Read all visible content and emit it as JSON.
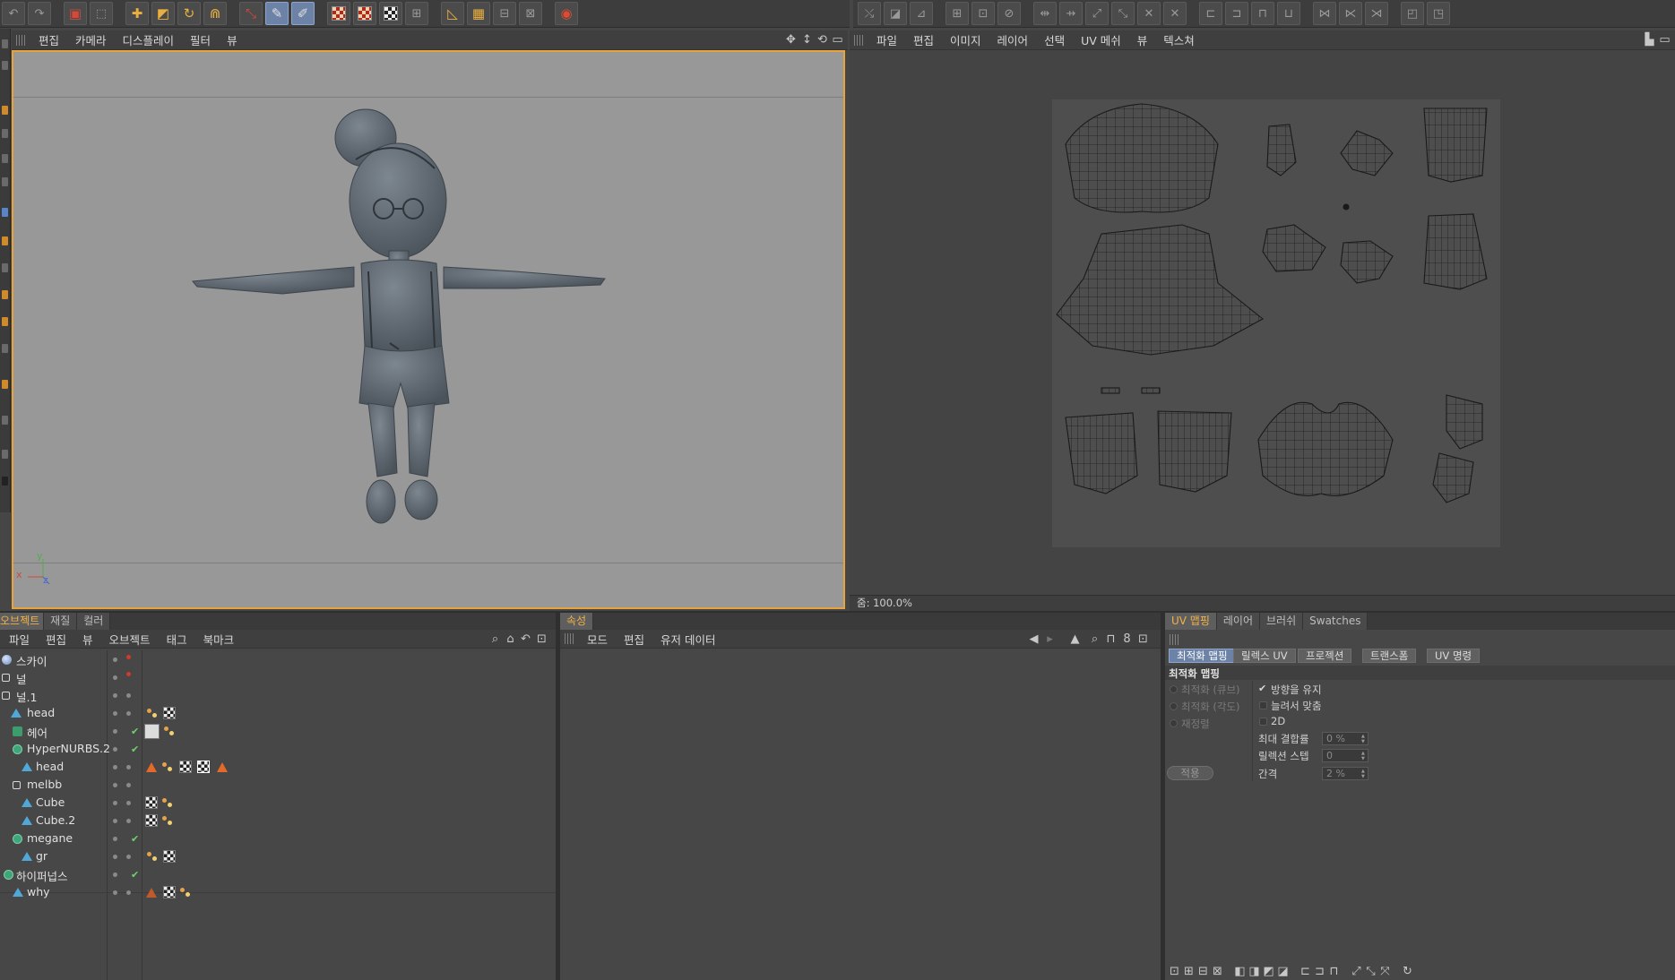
{
  "window": {
    "accent": "#e8a33a",
    "selection_blue": "#6c82a6"
  },
  "viewport": {
    "menu": [
      "편집",
      "카메라",
      "디스플레이",
      "필터",
      "뷰"
    ],
    "axis_labels": {
      "x": "x",
      "y": "y",
      "z": "z"
    },
    "border_color": "#e8a33a"
  },
  "uv_editor": {
    "menu": [
      "파일",
      "편집",
      "이미지",
      "레이어",
      "선택",
      "UV 메쉬",
      "뷰",
      "텍스쳐"
    ],
    "zoom_label": "줌: 100.0%"
  },
  "object_manager": {
    "tabs": [
      "오브젝트",
      "재질",
      "컬러"
    ],
    "menu": [
      "파일",
      "편집",
      "뷰",
      "오브젝트",
      "태그",
      "북마크"
    ],
    "objects": [
      {
        "name": "스카이",
        "icon": "sky-icon"
      },
      {
        "name": "널",
        "icon": "null-icon"
      },
      {
        "name": "널.1",
        "icon": "null-icon"
      },
      {
        "name": "head",
        "icon": "polygon-icon"
      },
      {
        "name": "헤어",
        "icon": "hair-icon"
      },
      {
        "name": "HyperNURBS.2",
        "icon": "nurbs-icon"
      },
      {
        "name": "head",
        "icon": "polygon-icon"
      },
      {
        "name": "melbb",
        "icon": "null-icon"
      },
      {
        "name": "Cube",
        "icon": "polygon-icon"
      },
      {
        "name": "Cube.2",
        "icon": "polygon-icon"
      },
      {
        "name": "megane",
        "icon": "nurbs-icon"
      },
      {
        "name": "gr",
        "icon": "polygon-icon"
      },
      {
        "name": "하이퍼넙스",
        "icon": "nurbs-icon"
      },
      {
        "name": "why",
        "icon": "polygon-icon"
      }
    ]
  },
  "attributes": {
    "tab": "속성",
    "menu": [
      "모드",
      "편집",
      "유저 데이터"
    ]
  },
  "uv_panel": {
    "tabs": [
      "UV 맵핑",
      "레이어",
      "브러쉬",
      "Swatches"
    ],
    "subtabs": [
      "최적화 맵핑",
      "릴렉스 UV",
      "프로젝션",
      "트랜스폼",
      "UV 명령"
    ],
    "section_title": "최적화 맵핑",
    "radios": [
      "최적화 (큐브)",
      "최적화 (각도)",
      "재정렬"
    ],
    "apply_label": "적용",
    "options": {
      "keep_orientation": "방향을 유지",
      "stretch_fit": "늘려서 맞춤",
      "two_d": "2D"
    },
    "fields": [
      {
        "label": "최대 결합률",
        "value": "0 %"
      },
      {
        "label": "릴렉션 스텝",
        "value": "0"
      },
      {
        "label": "간격",
        "value": "2 %"
      }
    ]
  }
}
